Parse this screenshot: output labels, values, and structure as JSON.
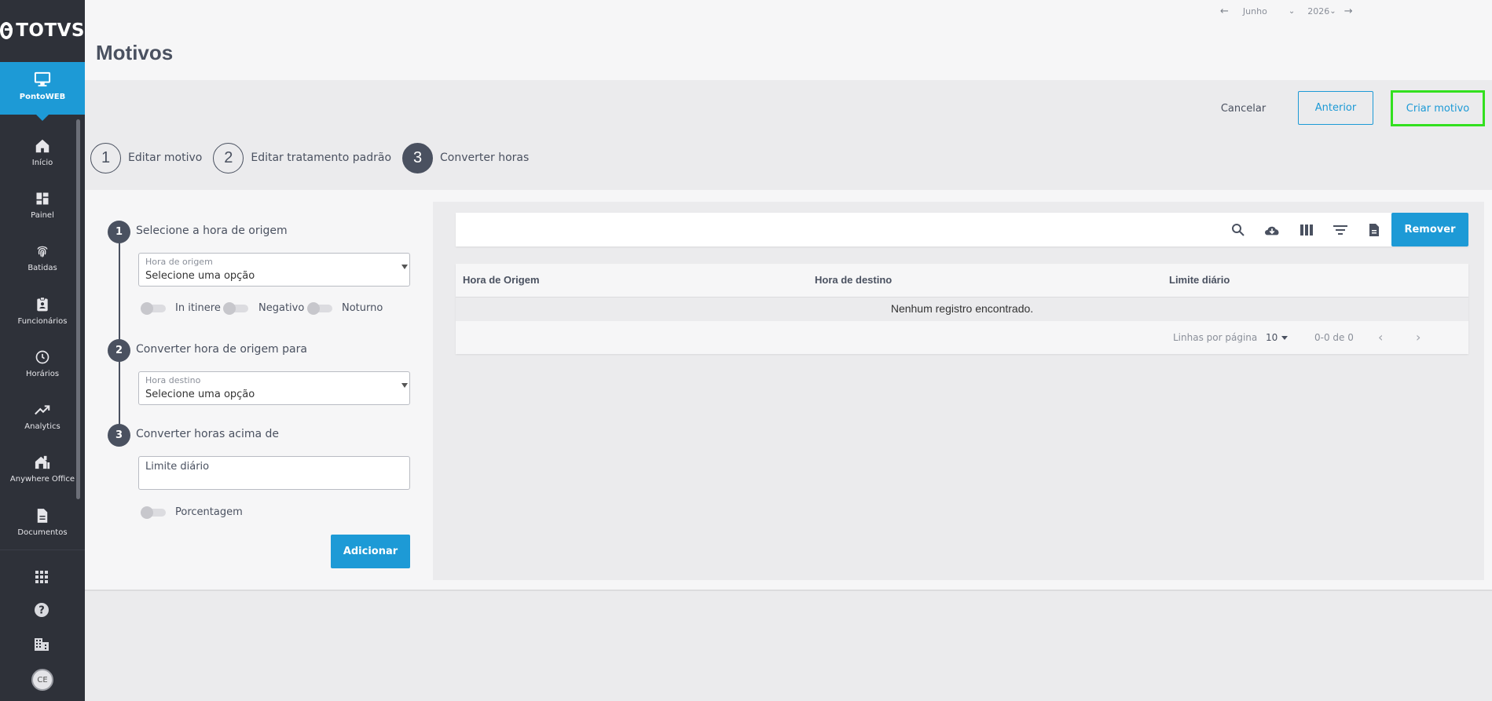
{
  "brand": {
    "logo_text": "TOTVS"
  },
  "sidebar": {
    "app": {
      "label": "PontoWEB",
      "icon": "monitor-icon"
    },
    "items": [
      {
        "label": "Início",
        "icon": "home-icon"
      },
      {
        "label": "Painel",
        "icon": "dashboard-icon"
      },
      {
        "label": "Batidas",
        "icon": "fingerprint-icon"
      },
      {
        "label": "Funcionários",
        "icon": "badge-icon"
      },
      {
        "label": "Horários",
        "icon": "clock-icon"
      },
      {
        "label": "Analytics",
        "icon": "trending-up-icon"
      },
      {
        "label": "Anywhere Office",
        "icon": "home-office-icon"
      },
      {
        "label": "Documentos",
        "icon": "document-icon"
      }
    ],
    "bottom": {
      "apps_icon": "apps-grid-icon",
      "help_icon": "help-icon",
      "company_icon": "building-icon",
      "avatar": "CE"
    }
  },
  "header": {
    "title": "Motivos",
    "date": {
      "month": "Junho",
      "year": "2026"
    }
  },
  "actions": {
    "cancel": "Cancelar",
    "previous": "Anterior",
    "create": "Criar motivo"
  },
  "stepper": [
    {
      "number": "1",
      "label": "Editar motivo",
      "active": false
    },
    {
      "number": "2",
      "label": "Editar tratamento padrão",
      "active": false
    },
    {
      "number": "3",
      "label": "Converter horas",
      "active": true
    }
  ],
  "form": {
    "section1": {
      "number": "1",
      "title": "Selecione a hora de origem"
    },
    "origin_select": {
      "label": "Hora de origem",
      "value": "Selecione uma opção"
    },
    "toggles": {
      "in_itinere": "In itinere",
      "negativo": "Negativo",
      "noturno": "Noturno"
    },
    "section2": {
      "number": "2",
      "title": "Converter hora de origem para"
    },
    "dest_select": {
      "label": "Hora destino",
      "value": "Selecione uma opção"
    },
    "section3": {
      "number": "3",
      "title": "Converter horas acima de"
    },
    "limit_input": {
      "placeholder": "Limite diário"
    },
    "percent_toggle": "Porcentagem",
    "add_button": "Adicionar"
  },
  "grid": {
    "remove_button": "Remover",
    "columns": [
      "Hora de Origem",
      "Hora de destino",
      "Limite diário"
    ],
    "empty_message": "Nenhum registro encontrado.",
    "pager": {
      "rows_per_page_label": "Linhas por página",
      "rows_per_page": "10",
      "range": "0-0 de 0"
    }
  }
}
